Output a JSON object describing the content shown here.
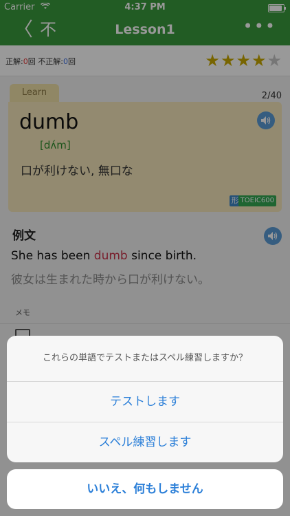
{
  "status": {
    "carrier": "Carrier",
    "time": "4:37 PM"
  },
  "nav": {
    "back": "〈",
    "kanji": "不",
    "title": "Lesson1",
    "more": "•••"
  },
  "score": {
    "correct_label": "正解:",
    "correct_value": "0",
    "correct_unit": "回",
    "wrong_label": "不正解:",
    "wrong_value": "0",
    "wrong_unit": "回",
    "rating": 4,
    "max_rating": 5
  },
  "card": {
    "tab_label": "Learn",
    "page": "2/40",
    "word": "dumb",
    "phonetic": "[dʌ́m]",
    "meaning": "口が利けない, 無口な",
    "part_of_speech": "形",
    "tag": "TOEIC600"
  },
  "example": {
    "title": "例文",
    "en_before": "She has been ",
    "en_highlight": "dumb",
    "en_after": " since birth.",
    "ja": "彼女は生まれた時から口が利けない。"
  },
  "memo": {
    "label": "メモ"
  },
  "sheet": {
    "message": "これらの単語でテストまたはスペル練習しますか？",
    "actions": [
      "テストします",
      "スペル練習します"
    ],
    "cancel": "いいえ、何もしません"
  },
  "colors": {
    "nav_green": "#3a9a3c",
    "accent_blue": "#2b7fd8",
    "card_yellow": "#f5e7bb",
    "star_gold": "#c9a800"
  }
}
